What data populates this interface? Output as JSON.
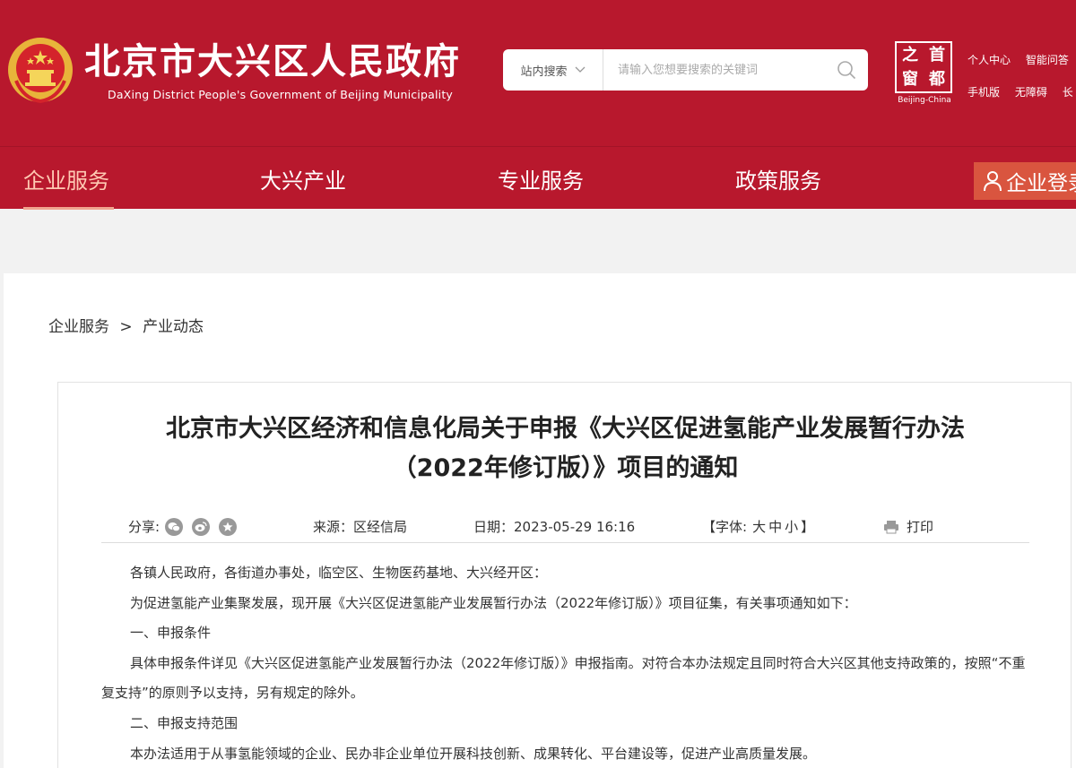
{
  "header": {
    "title": "北京市大兴区人民政府",
    "subtitle": "DaXing District People's Government of Beijing Municipality",
    "search": {
      "scope": "站内搜索",
      "placeholder": "请输入您想要搜索的关键词"
    },
    "capital_logo": {
      "chars": [
        "之",
        "首",
        "窗",
        "都"
      ],
      "label": "Beijing-China"
    },
    "top_links_row1": [
      "个人中心",
      "智能问答"
    ],
    "top_links_row2": [
      "手机版",
      "无障碍",
      "长"
    ]
  },
  "nav": {
    "items": [
      "企业服务",
      "大兴产业",
      "专业服务",
      "政策服务"
    ],
    "active": "企业服务",
    "login": "企业登录"
  },
  "breadcrumb": {
    "root": "企业服务",
    "separator": ">",
    "current": "产业动态"
  },
  "article": {
    "title_line1": "北京市大兴区经济和信息化局关于申报《大兴区促进氢能产业发展暂行办法",
    "title_line2": "（2022年修订版）》项目的通知",
    "meta": {
      "share_label": "分享:",
      "source_label": "来源：",
      "source": "区经信局",
      "date_label": "日期：",
      "date": "2023-05-29 16:16",
      "font_open": "【字体:",
      "font_sizes": [
        "大",
        "中",
        "小"
      ],
      "font_close": "】",
      "print": "打印"
    },
    "paragraphs": [
      "各镇人民政府，各街道办事处，临空区、生物医药基地、大兴经开区：",
      "为促进氢能产业集聚发展，现开展《大兴区促进氢能产业发展暂行办法（2022年修订版）》项目征集，有关事项通知如下：",
      "一、申报条件",
      "具体申报条件详见《大兴区促进氢能产业发展暂行办法（2022年修订版）》申报指南。对符合本办法规定且同时符合大兴区其他支持政策的，按照“不重复支持”的原则予以支持，另有规定的除外。",
      "二、申报支持范围",
      "本办法适用于从事氢能领域的企业、民办非企业单位开展科技创新、成果转化、平台建设等，促进产业高质量发展。"
    ]
  },
  "colors": {
    "brand_red": "#b8182d",
    "login_bg": "#d9553f",
    "nav_active": "#ffc9b3"
  }
}
